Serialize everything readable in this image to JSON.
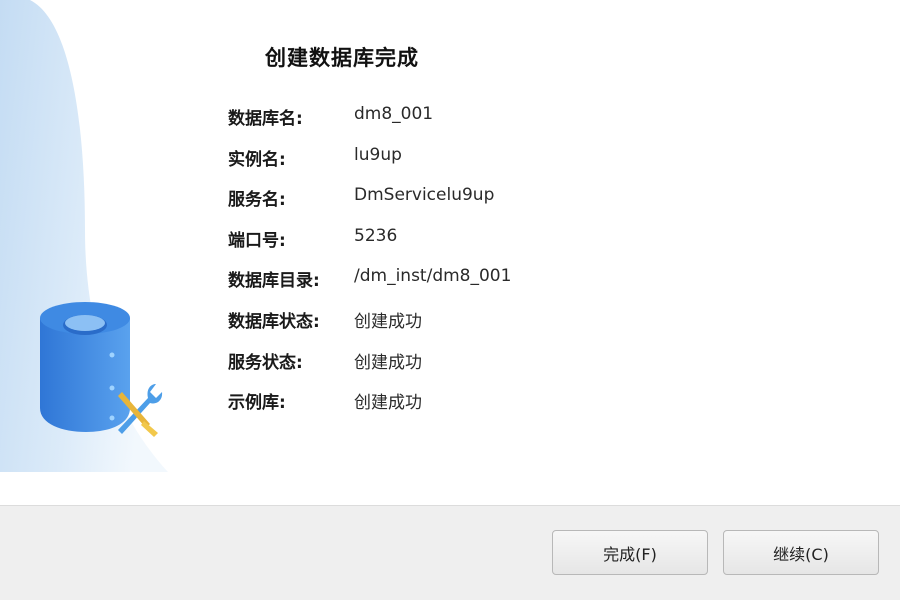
{
  "dialog": {
    "title": "创建数据库完成",
    "details": [
      {
        "label": "数据库名:",
        "value": "dm8_001"
      },
      {
        "label": "实例名:",
        "value": "lu9up"
      },
      {
        "label": "服务名:",
        "value": "DmServicelu9up"
      },
      {
        "label": "端口号:",
        "value": "5236"
      },
      {
        "label": "数据库目录:",
        "value": "/dm_inst/dm8_001"
      },
      {
        "label": "数据库状态:",
        "value": "创建成功"
      },
      {
        "label": "服务状态:",
        "value": "创建成功"
      },
      {
        "label": "示例库:",
        "value": "创建成功"
      }
    ]
  },
  "side_icon": "database-tool-icon",
  "buttons": {
    "finish_label": "完成(F)",
    "continue_label": "继续(C)"
  },
  "colors": {
    "accent_blue": "#3d86e0",
    "panel_gradient": "#cfe4f7",
    "footer_bg": "#efefef"
  }
}
